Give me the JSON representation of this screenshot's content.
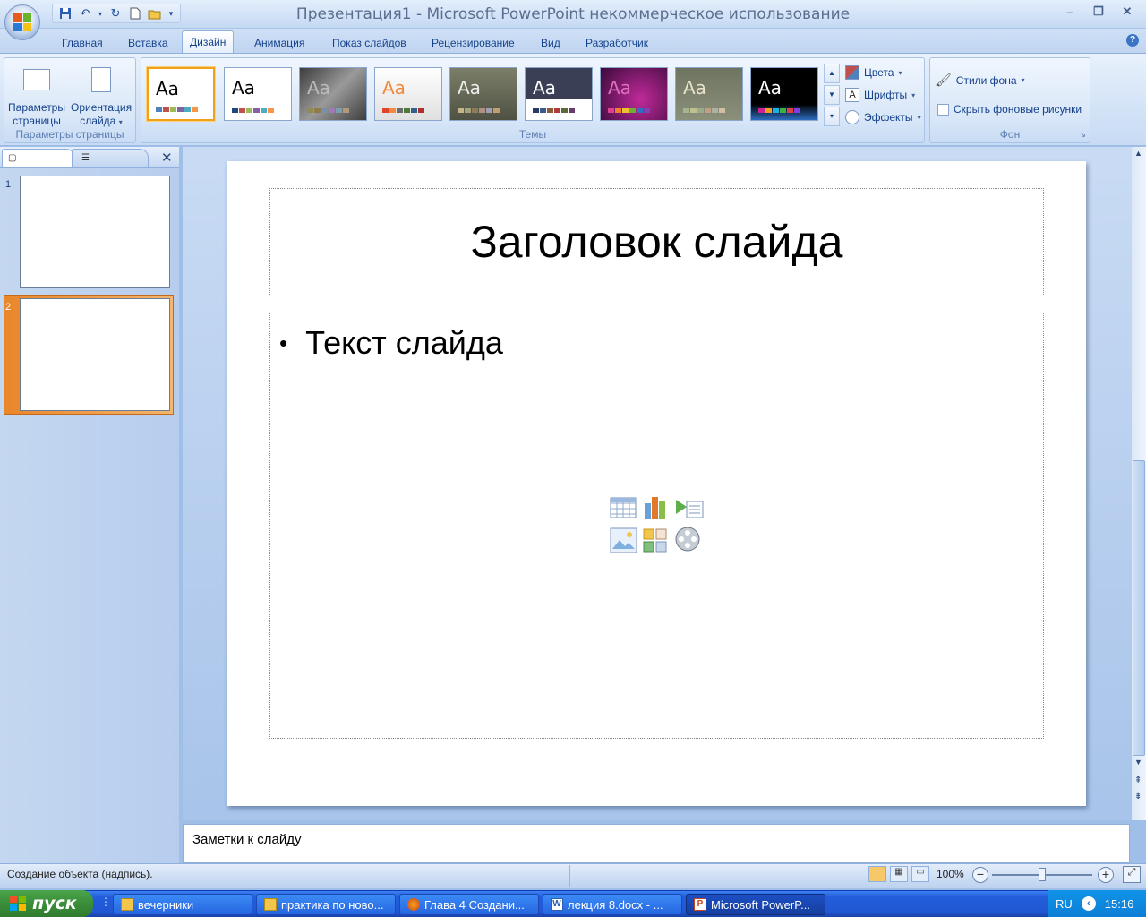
{
  "window": {
    "title": "Презентация1 - Microsoft PowerPoint некоммерческое использование"
  },
  "tabs": [
    "Главная",
    "Вставка",
    "Дизайн",
    "Анимация",
    "Показ слайдов",
    "Рецензирование",
    "Вид",
    "Разработчик"
  ],
  "active_tab": "Дизайн",
  "ribbon": {
    "page_setup": {
      "page_params": "Параметры страницы",
      "page_params_l1": "Параметры",
      "page_params_l2": "страницы",
      "orientation_l1": "Ориентация",
      "orientation_l2": "слайда",
      "group_label": "Параметры страницы"
    },
    "themes": {
      "group_label": "Темы",
      "sample_text": "Aa",
      "colors": "Цвета",
      "fonts": "Шрифты",
      "effects": "Эффекты"
    },
    "background": {
      "group_label": "Фон",
      "styles": "Стили фона",
      "hide_graphics": "Скрыть фоновые рисунки"
    }
  },
  "slides_pane": {
    "thumbnails": [
      {
        "number": "1"
      },
      {
        "number": "2"
      }
    ],
    "selected": "2"
  },
  "slide": {
    "title": "Заголовок слайда",
    "bullet": "Текст слайда"
  },
  "notes": {
    "placeholder": "Заметки к слайду"
  },
  "status": {
    "text": "Создание объекта (надпись).",
    "zoom": "100%"
  },
  "taskbar": {
    "start": "пуск",
    "items": [
      {
        "label": "вечерники"
      },
      {
        "label": "практика по ново..."
      },
      {
        "label": "Глава 4 Создани..."
      },
      {
        "label": "лекция 8.docx - ..."
      },
      {
        "label": "Microsoft PowerP..."
      }
    ],
    "lang": "RU",
    "clock": "15:16"
  },
  "colors": {
    "accent_orange": "#f0a11c",
    "ribbon_text": "#15428b",
    "taskbar_blue": "#245edb"
  }
}
